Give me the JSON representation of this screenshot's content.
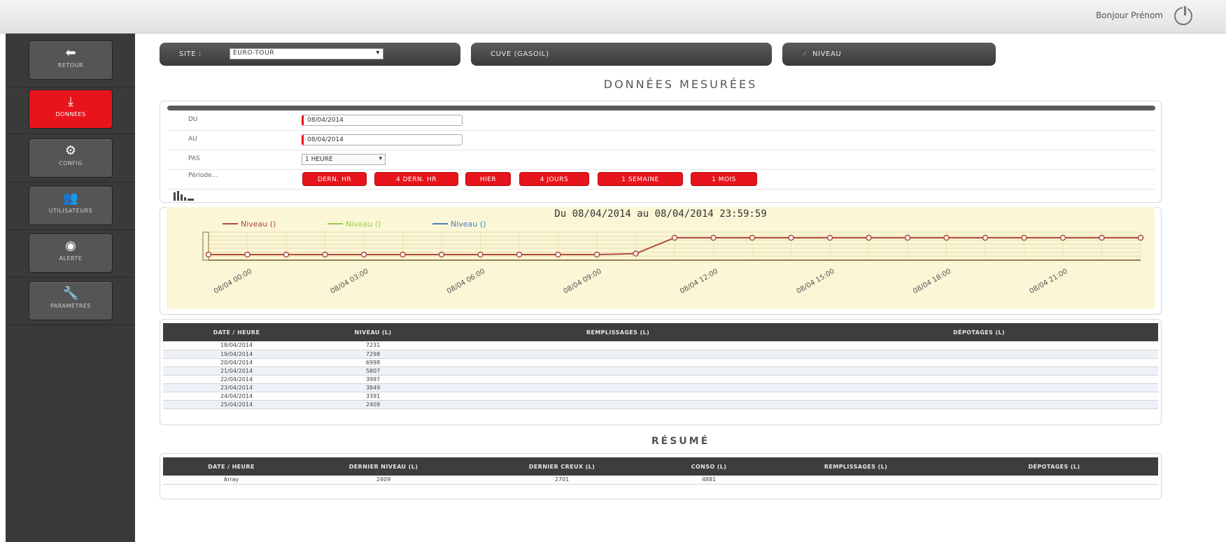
{
  "header": {
    "greeting": "Bonjour Prénom"
  },
  "sidebar": {
    "items": [
      {
        "label": "Retour",
        "icon": "back-arrow-icon",
        "active": false
      },
      {
        "label": "Données",
        "icon": "download-icon",
        "active": true
      },
      {
        "label": "Config",
        "icon": "gear-icon",
        "active": false
      },
      {
        "label": "Utilisateurs",
        "icon": "users-icon",
        "active": false
      },
      {
        "label": "Alerte",
        "icon": "alert-signal-icon",
        "active": false
      },
      {
        "label": "Paramètres",
        "icon": "wrench-icon",
        "active": false
      }
    ]
  },
  "toolbar": {
    "site_label": "SITE :",
    "site_value": "EURO-TOUR",
    "cuve_label": "CUVE (GASOIL)",
    "niveau_label": "NIVEAU"
  },
  "page_title": "DONNÉES MESURÉES",
  "filters": {
    "du_label": "DU",
    "du_value": "08/04/2014",
    "au_label": "AU",
    "au_value": "08/04/2014",
    "pas_label": "PAS",
    "pas_value": "1 HEURE",
    "period_label": "Période...",
    "period_buttons": [
      "DERN. HR",
      "4 DERN. HR",
      "HIER",
      "4 JOURS",
      "1 SEMAINE",
      "1 MOIS"
    ]
  },
  "chart_data": {
    "type": "line",
    "title": "Du 08/04/2014 au 08/04/2014 23:59:59",
    "legend": [
      "Niveau ()",
      "Niveau ()",
      "Niveau ()"
    ],
    "legend_placement": "top-left",
    "x_tick_labels": [
      "08/04 00:00",
      "08/04 03:00",
      "08/04 06:00",
      "08/04 09:00",
      "08/04 12:00",
      "08/04 15:00",
      "08/04 18:00",
      "08/04 21:00"
    ],
    "series": [
      {
        "name": "Niveau ()",
        "values": [
          5200,
          5200,
          5200,
          5200,
          5200,
          5200,
          5200,
          5200,
          5200,
          5200,
          5200,
          5400,
          8800,
          8800,
          8800,
          8800,
          8800,
          8800,
          8800,
          8800,
          8800,
          8800,
          8800,
          8800,
          8800
        ]
      }
    ],
    "ylim": [
      4000,
      10000
    ],
    "grid": true,
    "colors": {
      "line": "#b24a3c",
      "line2": "#9ccc4a",
      "line3": "#4a7fc1",
      "background": "#faf6d6"
    }
  },
  "data_table": {
    "columns": [
      "Date / Heure",
      "Niveau (L)",
      "Remplissages (L)",
      "Dépotages (L)"
    ],
    "rows": [
      [
        "18/04/2014",
        "7231",
        "",
        ""
      ],
      [
        "19/04/2014",
        "7298",
        "",
        ""
      ],
      [
        "20/04/2014",
        "6998",
        "",
        ""
      ],
      [
        "21/04/2014",
        "5807",
        "",
        ""
      ],
      [
        "22/04/2014",
        "3997",
        "",
        ""
      ],
      [
        "23/04/2014",
        "3849",
        "",
        ""
      ],
      [
        "24/04/2014",
        "3391",
        "",
        ""
      ],
      [
        "25/04/2014",
        "2409",
        "",
        ""
      ]
    ]
  },
  "resume_title": "RÉSUMÉ",
  "resume_table": {
    "columns": [
      "Date / Heure",
      "Dernier Niveau (L)",
      "Dernier Creux (L)",
      "Conso (L)",
      "Remplissages (L)",
      "Dépotages (L)"
    ],
    "rows": [
      [
        "Array",
        "2409",
        "2701",
        "4881",
        "",
        ""
      ]
    ]
  }
}
